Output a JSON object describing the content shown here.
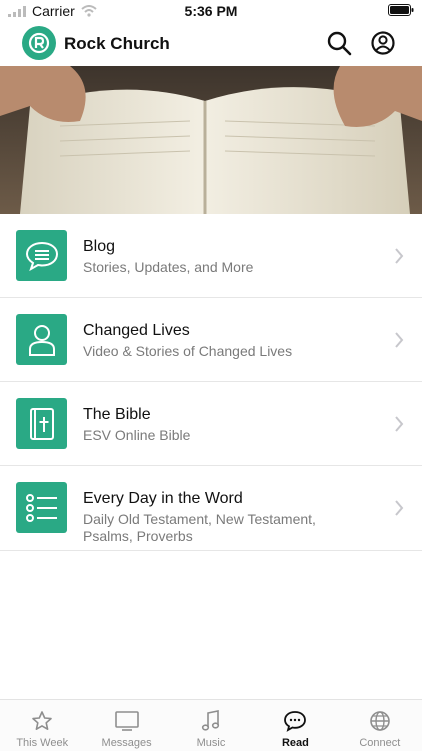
{
  "status_bar": {
    "carrier": "Carrier",
    "time": "5:36 PM"
  },
  "header": {
    "title": "Rock Church",
    "logo_icon": "rock-church-logo",
    "accent": "#2aa985"
  },
  "menu": [
    {
      "title": "Blog",
      "subtitle": "Stories, Updates, and More",
      "icon": "chat-bubble-icon"
    },
    {
      "title": "Changed Lives",
      "subtitle": "Video & Stories of Changed Lives",
      "icon": "person-icon"
    },
    {
      "title": "The Bible",
      "subtitle": "ESV Online Bible",
      "icon": "bible-icon"
    },
    {
      "title": "Every Day in the Word",
      "subtitle": "Daily Old Testament, New Testament, Psalms, Proverbs",
      "icon": "list-icon"
    }
  ],
  "tabs": [
    {
      "label": "This Week",
      "icon": "star-icon",
      "active": false
    },
    {
      "label": "Messages",
      "icon": "tv-icon",
      "active": false
    },
    {
      "label": "Music",
      "icon": "music-note-icon",
      "active": false
    },
    {
      "label": "Read",
      "icon": "chat-bubble-icon",
      "active": true
    },
    {
      "label": "Connect",
      "icon": "globe-icon",
      "active": false
    }
  ]
}
